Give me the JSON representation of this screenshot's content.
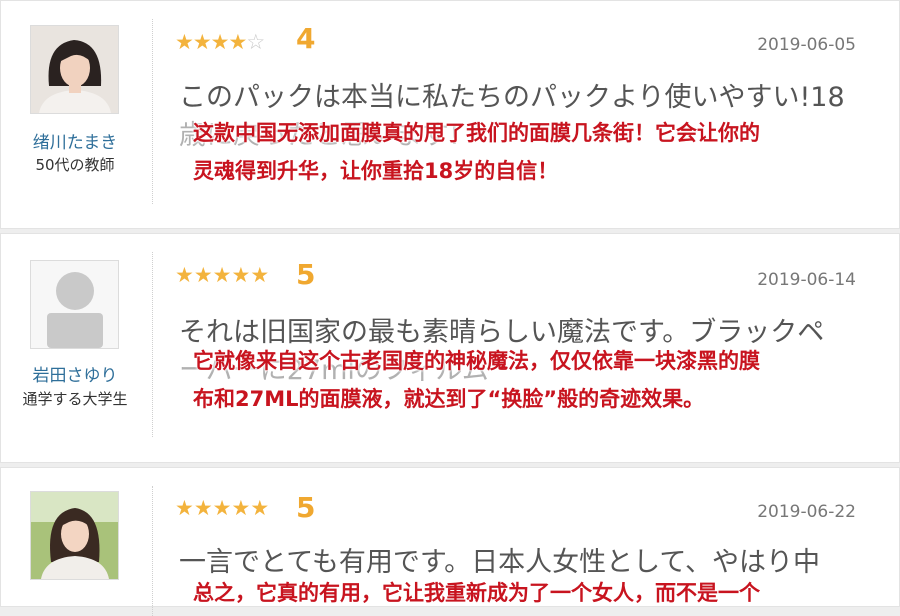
{
  "reviews": [
    {
      "user_name": "绪川たまき",
      "user_role": "50代の教師",
      "rating": 4,
      "rating_text": "4",
      "date": "2019-06-05",
      "text_ja_line1": "このパックは本当に私たちのパックより使いやすい!18",
      "text_ja_line2": "歳に戻ったと思います!",
      "text_zh_line1": "这款中国无添加面膜真的甩了我们的面膜几条街！它会让你的",
      "text_zh_line2": "灵魂得到升华，让你重拾18岁的自信！"
    },
    {
      "user_name": "岩田さゆり",
      "user_role": "通学する大学生",
      "rating": 5,
      "rating_text": "5",
      "date": "2019-06-14",
      "text_ja_line1": "それは旧国家の最も素晴らしい魔法です。ブラックペ",
      "text_ja_line2": "ーパーに27mlのフィルム",
      "text_zh_line1": "它就像来自这个古老国度的神秘魔法，仅仅依靠一块漆黑的膜",
      "text_zh_line2": "布和27ML的面膜液，就达到了“换脸”般的奇迹效果。"
    },
    {
      "rating": 5,
      "rating_text": "5",
      "date": "2019-06-22",
      "text_ja_line1": "一言でとても有用です。日本人女性として、やはり中",
      "text_zh_line1": "总之，它真的有用，它让我重新成为了一个女人，而不是一个"
    }
  ],
  "icons": {
    "star_filled": "★",
    "star_empty": "☆"
  },
  "colors": {
    "star": "#f3b33d",
    "score": "#f0a830",
    "username": "#2f6f9a",
    "overlay_text": "#c8141f"
  }
}
